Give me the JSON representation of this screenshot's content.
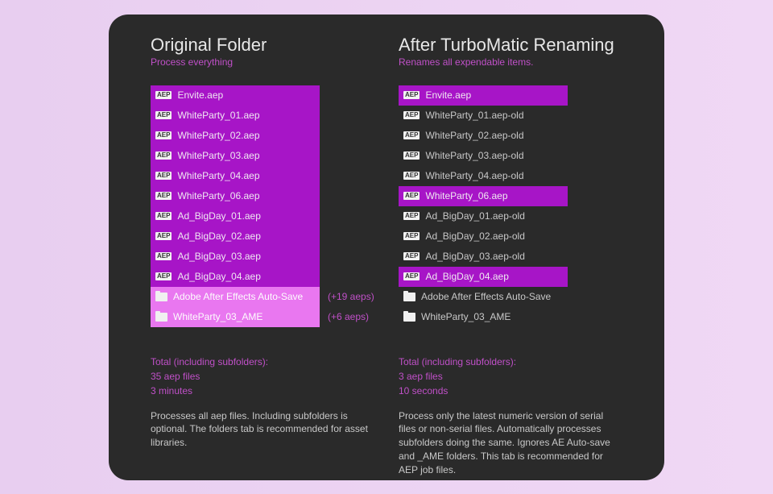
{
  "left": {
    "title": "Original Folder",
    "subtitle": "Process everything",
    "items": [
      {
        "type": "file",
        "label": "Envite.aep",
        "style": "purple"
      },
      {
        "type": "file",
        "label": "WhiteParty_01.aep",
        "style": "purple"
      },
      {
        "type": "file",
        "label": "WhiteParty_02.aep",
        "style": "purple"
      },
      {
        "type": "file",
        "label": "WhiteParty_03.aep",
        "style": "purple"
      },
      {
        "type": "file",
        "label": "WhiteParty_04.aep",
        "style": "purple"
      },
      {
        "type": "file",
        "label": "WhiteParty_06.aep",
        "style": "purple"
      },
      {
        "type": "file",
        "label": "Ad_BigDay_01.aep",
        "style": "purple"
      },
      {
        "type": "file",
        "label": "Ad_BigDay_02.aep",
        "style": "purple"
      },
      {
        "type": "file",
        "label": "Ad_BigDay_03.aep",
        "style": "purple"
      },
      {
        "type": "file",
        "label": "Ad_BigDay_04.aep",
        "style": "purple"
      },
      {
        "type": "folder",
        "label": "Adobe After Effects Auto-Save",
        "style": "pink",
        "aside": "(+19 aeps)"
      },
      {
        "type": "folder",
        "label": "WhiteParty_03_AME",
        "style": "pink",
        "aside": "(+6 aeps)"
      }
    ],
    "stats": [
      "Total (including subfolders):",
      "35 aep files",
      "3 minutes"
    ],
    "desc": "Processes all aep files. Including subfolders is optional. The folders tab is recommended for asset libraries."
  },
  "right": {
    "title": "After TurboMatic Renaming",
    "subtitle": "Renames all expendable items.",
    "items": [
      {
        "type": "file",
        "label": "Envite.aep",
        "style": "purple"
      },
      {
        "type": "file",
        "label": "WhiteParty_01.aep-old",
        "style": "none"
      },
      {
        "type": "file",
        "label": "WhiteParty_02.aep-old",
        "style": "none"
      },
      {
        "type": "file",
        "label": "WhiteParty_03.aep-old",
        "style": "none"
      },
      {
        "type": "file",
        "label": "WhiteParty_04.aep-old",
        "style": "none"
      },
      {
        "type": "file",
        "label": "WhiteParty_06.aep",
        "style": "purple"
      },
      {
        "type": "file",
        "label": "Ad_BigDay_01.aep-old",
        "style": "none"
      },
      {
        "type": "file",
        "label": "Ad_BigDay_02.aep-old",
        "style": "none"
      },
      {
        "type": "file",
        "label": "Ad_BigDay_03.aep-old",
        "style": "none"
      },
      {
        "type": "file",
        "label": "Ad_BigDay_04.aep",
        "style": "purple"
      },
      {
        "type": "folder",
        "label": "Adobe After Effects Auto-Save",
        "style": "none"
      },
      {
        "type": "folder",
        "label": "WhiteParty_03_AME",
        "style": "none"
      }
    ],
    "stats": [
      "Total (including subfolders):",
      "3 aep files",
      "10 seconds"
    ],
    "desc": "Process only the latest numeric version of serial files or non-serial files. Automatically processes subfolders doing the same. Ignores AE Auto-save and _AME folders. This tab is recommended for AEP job files."
  },
  "badge_text": "AEP"
}
